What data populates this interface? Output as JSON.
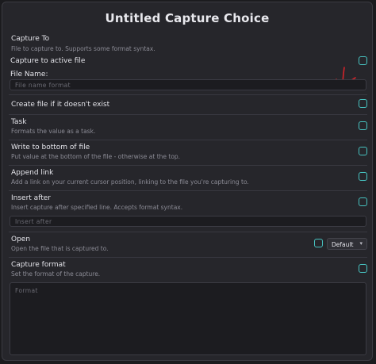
{
  "modal": {
    "title": "Untitled Capture Choice",
    "capture_to": {
      "label": "Capture To",
      "description": "File to capture to. Supports some format syntax."
    },
    "capture_active": {
      "label": "Capture to active file",
      "checked": false
    },
    "file_name": {
      "label": "File Name:",
      "placeholder": "File name format"
    },
    "create_if_missing": {
      "label": "Create file if it doesn't exist",
      "checked": false
    },
    "task": {
      "label": "Task",
      "description": "Formats the value as a task.",
      "checked": false
    },
    "write_bottom": {
      "label": "Write to bottom of file",
      "description": "Put value at the bottom of the file - otherwise at the top.",
      "checked": false
    },
    "append_link": {
      "label": "Append link",
      "description": "Add a link on your current cursor position, linking to the file you're capturing to.",
      "checked": false
    },
    "insert_after": {
      "label": "Insert after",
      "description": "Insert capture after specified line. Accepts format syntax.",
      "placeholder": "Insert after",
      "checked": false
    },
    "open": {
      "label": "Open",
      "description": "Open the file that is captured to.",
      "checked": false,
      "select_value": "Default",
      "chevron_icon": "chevron-down-icon"
    },
    "capture_format": {
      "label": "Capture format",
      "description": "Set the format of the capture.",
      "placeholder": "Format",
      "checked": false
    }
  },
  "annotation": {
    "color": "#d2232a",
    "icon": "hand-drawn-arrow-icon"
  },
  "colors": {
    "accent": "#47c2c0",
    "background": "#26262b",
    "text": "#e4e4ea",
    "muted": "#8b8b95"
  }
}
